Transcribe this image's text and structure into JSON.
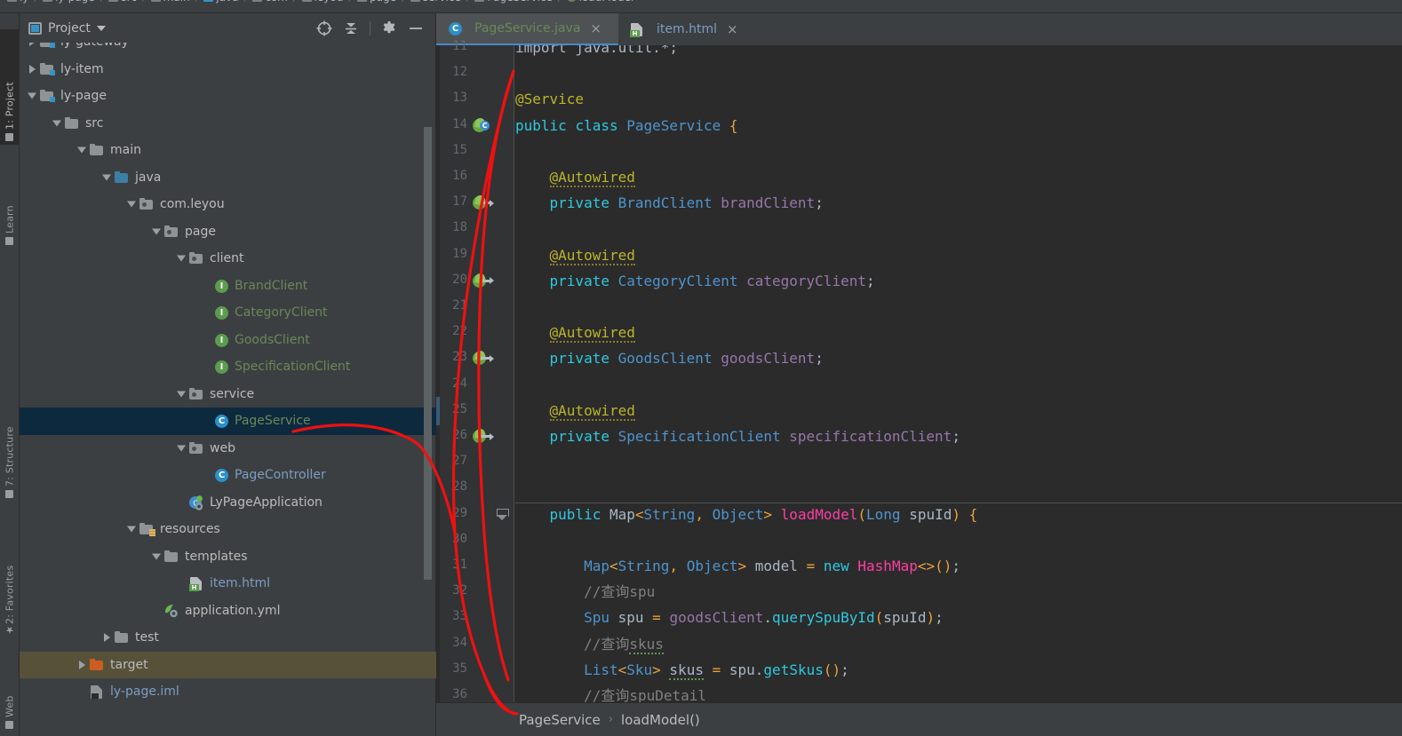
{
  "navbar": {
    "items": [
      {
        "label": "ly",
        "icon": "module-icon"
      },
      {
        "label": "ly-page",
        "icon": "module-icon"
      },
      {
        "label": "src",
        "icon": "folder-icon"
      },
      {
        "label": "main",
        "icon": "folder-icon"
      },
      {
        "label": "java",
        "icon": "source-folder-icon"
      },
      {
        "label": "com",
        "icon": "package-icon"
      },
      {
        "label": "leyou",
        "icon": "package-icon"
      },
      {
        "label": "page",
        "icon": "package-icon"
      },
      {
        "label": "service",
        "icon": "package-icon"
      },
      {
        "label": "PageService",
        "icon": "class-icon"
      },
      {
        "label": "loadModel",
        "icon": "method-icon"
      }
    ]
  },
  "left_tool_strip": {
    "tabs": [
      {
        "label": "1: Project",
        "active": true
      },
      {
        "label": "Learn",
        "active": false
      },
      {
        "label": "7: Structure",
        "active": false
      },
      {
        "label": "2: Favorites",
        "active": false
      },
      {
        "label": "Web",
        "active": false
      }
    ]
  },
  "project_panel": {
    "title": "Project",
    "toolbar": [
      {
        "name": "locate-icon",
        "tooltip": "Select Opened File"
      },
      {
        "name": "collapse-all-icon",
        "tooltip": "Collapse All"
      },
      {
        "name": "gear-icon",
        "tooltip": "Settings"
      },
      {
        "name": "hide-icon",
        "tooltip": "Hide"
      }
    ],
    "tree": [
      {
        "label": "ly-gateway",
        "indent": 1,
        "twisty": "right",
        "icon": "module-folder-icon",
        "color": "norm",
        "state": "clipped"
      },
      {
        "label": "ly-item",
        "indent": 1,
        "twisty": "right",
        "icon": "module-folder-icon",
        "color": "norm"
      },
      {
        "label": "ly-page",
        "indent": 1,
        "twisty": "down",
        "icon": "module-folder-icon",
        "color": "norm"
      },
      {
        "label": "src",
        "indent": 2,
        "twisty": "down",
        "icon": "folder-icon",
        "color": "norm"
      },
      {
        "label": "main",
        "indent": 3,
        "twisty": "down",
        "icon": "folder-icon",
        "color": "norm"
      },
      {
        "label": "java",
        "indent": 4,
        "twisty": "down",
        "icon": "source-folder-icon",
        "color": "norm"
      },
      {
        "label": "com.leyou",
        "indent": 5,
        "twisty": "down",
        "icon": "package-icon",
        "color": "norm"
      },
      {
        "label": "page",
        "indent": 6,
        "twisty": "down",
        "icon": "package-icon",
        "color": "norm"
      },
      {
        "label": "client",
        "indent": 7,
        "twisty": "down",
        "icon": "package-icon",
        "color": "norm"
      },
      {
        "label": "BrandClient",
        "indent": 8,
        "twisty": "none",
        "icon": "interface-icon",
        "color": "green"
      },
      {
        "label": "CategoryClient",
        "indent": 8,
        "twisty": "none",
        "icon": "interface-icon",
        "color": "green"
      },
      {
        "label": "GoodsClient",
        "indent": 8,
        "twisty": "none",
        "icon": "interface-icon",
        "color": "green"
      },
      {
        "label": "SpecificationClient",
        "indent": 8,
        "twisty": "none",
        "icon": "interface-icon",
        "color": "green"
      },
      {
        "label": "service",
        "indent": 7,
        "twisty": "down",
        "icon": "package-icon",
        "color": "norm"
      },
      {
        "label": "PageService",
        "indent": 8,
        "twisty": "none",
        "icon": "class-icon",
        "color": "green",
        "selected": true
      },
      {
        "label": "web",
        "indent": 7,
        "twisty": "down",
        "icon": "package-icon",
        "color": "norm"
      },
      {
        "label": "PageController",
        "indent": 8,
        "twisty": "none",
        "icon": "class-icon",
        "color": "blue"
      },
      {
        "label": "LyPageApplication",
        "indent": 7,
        "twisty": "none",
        "icon": "spring-run-icon",
        "color": "norm"
      },
      {
        "label": "resources",
        "indent": 5,
        "twisty": "down",
        "icon": "resources-folder-icon",
        "color": "norm"
      },
      {
        "label": "templates",
        "indent": 6,
        "twisty": "down",
        "icon": "folder-icon",
        "color": "norm"
      },
      {
        "label": "item.html",
        "indent": 7,
        "twisty": "none",
        "icon": "html-file-icon",
        "color": "blue"
      },
      {
        "label": "application.yml",
        "indent": 6,
        "twisty": "none",
        "icon": "spring-yml-icon",
        "color": "norm"
      },
      {
        "label": "test",
        "indent": 4,
        "twisty": "right",
        "icon": "folder-icon",
        "color": "norm"
      },
      {
        "label": "target",
        "indent": 3,
        "twisty": "right",
        "icon": "excluded-folder-icon",
        "color": "norm",
        "highlight": "target"
      },
      {
        "label": "ly-page.iml",
        "indent": 3,
        "twisty": "none",
        "icon": "iml-file-icon",
        "color": "blue"
      }
    ]
  },
  "editor": {
    "tabs": [
      {
        "label": "PageService.java",
        "icon": "class-icon",
        "color": "green",
        "active": true,
        "closable": true
      },
      {
        "label": "item.html",
        "icon": "html-file-icon",
        "color": "blue",
        "active": false,
        "closable": true
      }
    ],
    "close_glyph": "×",
    "first_visible_line": 11,
    "lines": [
      {
        "num": 11,
        "clipped": true,
        "tokens": [
          {
            "t": "import java.util.*;",
            "c": "plain"
          }
        ]
      },
      {
        "num": 12,
        "tokens": []
      },
      {
        "num": 13,
        "tokens": [
          {
            "t": "@Service",
            "c": "ann"
          }
        ]
      },
      {
        "num": 14,
        "gutter": "bean-class",
        "tokens": [
          {
            "t": "public",
            "c": "kw"
          },
          {
            "t": " ",
            "c": "plain"
          },
          {
            "t": "class",
            "c": "kw"
          },
          {
            "t": " ",
            "c": "plain"
          },
          {
            "t": "PageService",
            "c": "type"
          },
          {
            "t": " ",
            "c": "plain"
          },
          {
            "t": "{",
            "c": "brace"
          }
        ]
      },
      {
        "num": 15,
        "tokens": []
      },
      {
        "num": 16,
        "tokens": [
          {
            "t": "    ",
            "c": "plain"
          },
          {
            "t": "@Autowired",
            "c": "ann",
            "wavy": true
          }
        ]
      },
      {
        "num": 17,
        "gutter": "bean-arrow",
        "tokens": [
          {
            "t": "    ",
            "c": "plain"
          },
          {
            "t": "private",
            "c": "kw"
          },
          {
            "t": " ",
            "c": "plain"
          },
          {
            "t": "BrandClient",
            "c": "type"
          },
          {
            "t": " ",
            "c": "plain"
          },
          {
            "t": "brandClient",
            "c": "field"
          },
          {
            "t": ";",
            "c": "plain"
          }
        ]
      },
      {
        "num": 18,
        "tokens": []
      },
      {
        "num": 19,
        "tokens": [
          {
            "t": "    ",
            "c": "plain"
          },
          {
            "t": "@Autowired",
            "c": "ann",
            "wavy": true
          }
        ]
      },
      {
        "num": 20,
        "gutter": "bean-arrow",
        "tokens": [
          {
            "t": "    ",
            "c": "plain"
          },
          {
            "t": "private",
            "c": "kw"
          },
          {
            "t": " ",
            "c": "plain"
          },
          {
            "t": "CategoryClient",
            "c": "type"
          },
          {
            "t": " ",
            "c": "plain"
          },
          {
            "t": "categoryClient",
            "c": "field"
          },
          {
            "t": ";",
            "c": "plain"
          }
        ]
      },
      {
        "num": 21,
        "tokens": []
      },
      {
        "num": 22,
        "tokens": [
          {
            "t": "    ",
            "c": "plain"
          },
          {
            "t": "@Autowired",
            "c": "ann",
            "wavy": true
          }
        ]
      },
      {
        "num": 23,
        "gutter": "bean-arrow",
        "tokens": [
          {
            "t": "    ",
            "c": "plain"
          },
          {
            "t": "private",
            "c": "kw"
          },
          {
            "t": " ",
            "c": "plain"
          },
          {
            "t": "GoodsClient",
            "c": "type"
          },
          {
            "t": " ",
            "c": "plain"
          },
          {
            "t": "goodsClient",
            "c": "field"
          },
          {
            "t": ";",
            "c": "plain"
          }
        ]
      },
      {
        "num": 24,
        "tokens": []
      },
      {
        "num": 25,
        "tokens": [
          {
            "t": "    ",
            "c": "plain"
          },
          {
            "t": "@Autowired",
            "c": "ann",
            "wavy": true
          }
        ]
      },
      {
        "num": 26,
        "gutter": "bean-arrow",
        "tokens": [
          {
            "t": "    ",
            "c": "plain"
          },
          {
            "t": "private",
            "c": "kw"
          },
          {
            "t": " ",
            "c": "plain"
          },
          {
            "t": "SpecificationClient",
            "c": "type"
          },
          {
            "t": " ",
            "c": "plain"
          },
          {
            "t": "specificationClient",
            "c": "field"
          },
          {
            "t": ";",
            "c": "plain"
          }
        ]
      },
      {
        "num": 27,
        "tokens": []
      },
      {
        "num": 28,
        "tokens": []
      },
      {
        "num": 29,
        "fold": true,
        "sep": true,
        "tokens": [
          {
            "t": "    ",
            "c": "plain"
          },
          {
            "t": "public",
            "c": "kw"
          },
          {
            "t": " ",
            "c": "plain"
          },
          {
            "t": "Map",
            "c": "gray"
          },
          {
            "t": "<",
            "c": "brace"
          },
          {
            "t": "String",
            "c": "type"
          },
          {
            "t": ",",
            "c": "brace"
          },
          {
            "t": " ",
            "c": "plain"
          },
          {
            "t": "Object",
            "c": "type"
          },
          {
            "t": ">",
            "c": "brace"
          },
          {
            "t": " ",
            "c": "plain"
          },
          {
            "t": "loadModel",
            "c": "method"
          },
          {
            "t": "(",
            "c": "brace"
          },
          {
            "t": "Long",
            "c": "type"
          },
          {
            "t": " ",
            "c": "plain"
          },
          {
            "t": "spuId",
            "c": "plain"
          },
          {
            "t": ")",
            "c": "brace"
          },
          {
            "t": " ",
            "c": "plain"
          },
          {
            "t": "{",
            "c": "brace"
          }
        ]
      },
      {
        "num": 30,
        "tokens": []
      },
      {
        "num": 31,
        "tokens": [
          {
            "t": "        ",
            "c": "plain"
          },
          {
            "t": "Map",
            "c": "type"
          },
          {
            "t": "<",
            "c": "brace"
          },
          {
            "t": "String",
            "c": "type"
          },
          {
            "t": ",",
            "c": "brace"
          },
          {
            "t": " ",
            "c": "plain"
          },
          {
            "t": "Object",
            "c": "type"
          },
          {
            "t": ">",
            "c": "brace"
          },
          {
            "t": " ",
            "c": "plain"
          },
          {
            "t": "model",
            "c": "plain"
          },
          {
            "t": " ",
            "c": "plain"
          },
          {
            "t": "=",
            "c": "brace"
          },
          {
            "t": " ",
            "c": "plain"
          },
          {
            "t": "new",
            "c": "kw"
          },
          {
            "t": " ",
            "c": "plain"
          },
          {
            "t": "HashMap",
            "c": "method"
          },
          {
            "t": "<>",
            "c": "brace"
          },
          {
            "t": "(",
            "c": "brace"
          },
          {
            "t": ")",
            "c": "brace"
          },
          {
            "t": ";",
            "c": "plain"
          }
        ]
      },
      {
        "num": 32,
        "tokens": [
          {
            "t": "        ",
            "c": "plain"
          },
          {
            "t": "//查询spu",
            "c": "comm"
          }
        ]
      },
      {
        "num": 33,
        "tokens": [
          {
            "t": "        ",
            "c": "plain"
          },
          {
            "t": "Spu",
            "c": "type"
          },
          {
            "t": " ",
            "c": "plain"
          },
          {
            "t": "spu",
            "c": "plain"
          },
          {
            "t": " ",
            "c": "plain"
          },
          {
            "t": "=",
            "c": "brace"
          },
          {
            "t": " ",
            "c": "plain"
          },
          {
            "t": "goodsClient",
            "c": "field"
          },
          {
            "t": ".",
            "c": "plain"
          },
          {
            "t": "querySpuById",
            "c": "call"
          },
          {
            "t": "(",
            "c": "brace"
          },
          {
            "t": "spuId",
            "c": "plain"
          },
          {
            "t": ")",
            "c": "brace"
          },
          {
            "t": ";",
            "c": "plain"
          }
        ]
      },
      {
        "num": 34,
        "tokens": [
          {
            "t": "        ",
            "c": "plain"
          },
          {
            "t": "//查询",
            "c": "comm"
          },
          {
            "t": "skus",
            "c": "comm",
            "wavyg": true
          }
        ]
      },
      {
        "num": 35,
        "tokens": [
          {
            "t": "        ",
            "c": "plain"
          },
          {
            "t": "List",
            "c": "type"
          },
          {
            "t": "<",
            "c": "brace"
          },
          {
            "t": "Sku",
            "c": "type"
          },
          {
            "t": ">",
            "c": "brace"
          },
          {
            "t": " ",
            "c": "plain"
          },
          {
            "t": "skus",
            "c": "plain",
            "wavyg": true
          },
          {
            "t": " ",
            "c": "plain"
          },
          {
            "t": "=",
            "c": "brace"
          },
          {
            "t": " ",
            "c": "plain"
          },
          {
            "t": "spu",
            "c": "plain"
          },
          {
            "t": ".",
            "c": "plain"
          },
          {
            "t": "getSkus",
            "c": "call"
          },
          {
            "t": "(",
            "c": "brace"
          },
          {
            "t": ")",
            "c": "brace"
          },
          {
            "t": ";",
            "c": "plain"
          }
        ]
      },
      {
        "num": 36,
        "tokens": [
          {
            "t": "        ",
            "c": "plain"
          },
          {
            "t": "//查询spuDetail",
            "c": "comm"
          }
        ]
      }
    ],
    "breadcrumb": {
      "items": [
        "PageService",
        "loadModel()"
      ],
      "separator": "›"
    }
  },
  "colors": {
    "panel_bg": "#3c3f41",
    "editor_bg": "#2b2b2b",
    "gutter_bg": "#313335",
    "selection_bg": "#0d293e",
    "target_bg": "#57513a",
    "accent_blue": "#3592c4",
    "annotation_red": "#ee1111",
    "text": "#bbbbbb"
  },
  "annotation": {
    "type": "hand-drawn-arrow",
    "color": "#ee1111",
    "description": "red curve from PageService tree node looping down to breadcrumb PageService"
  }
}
